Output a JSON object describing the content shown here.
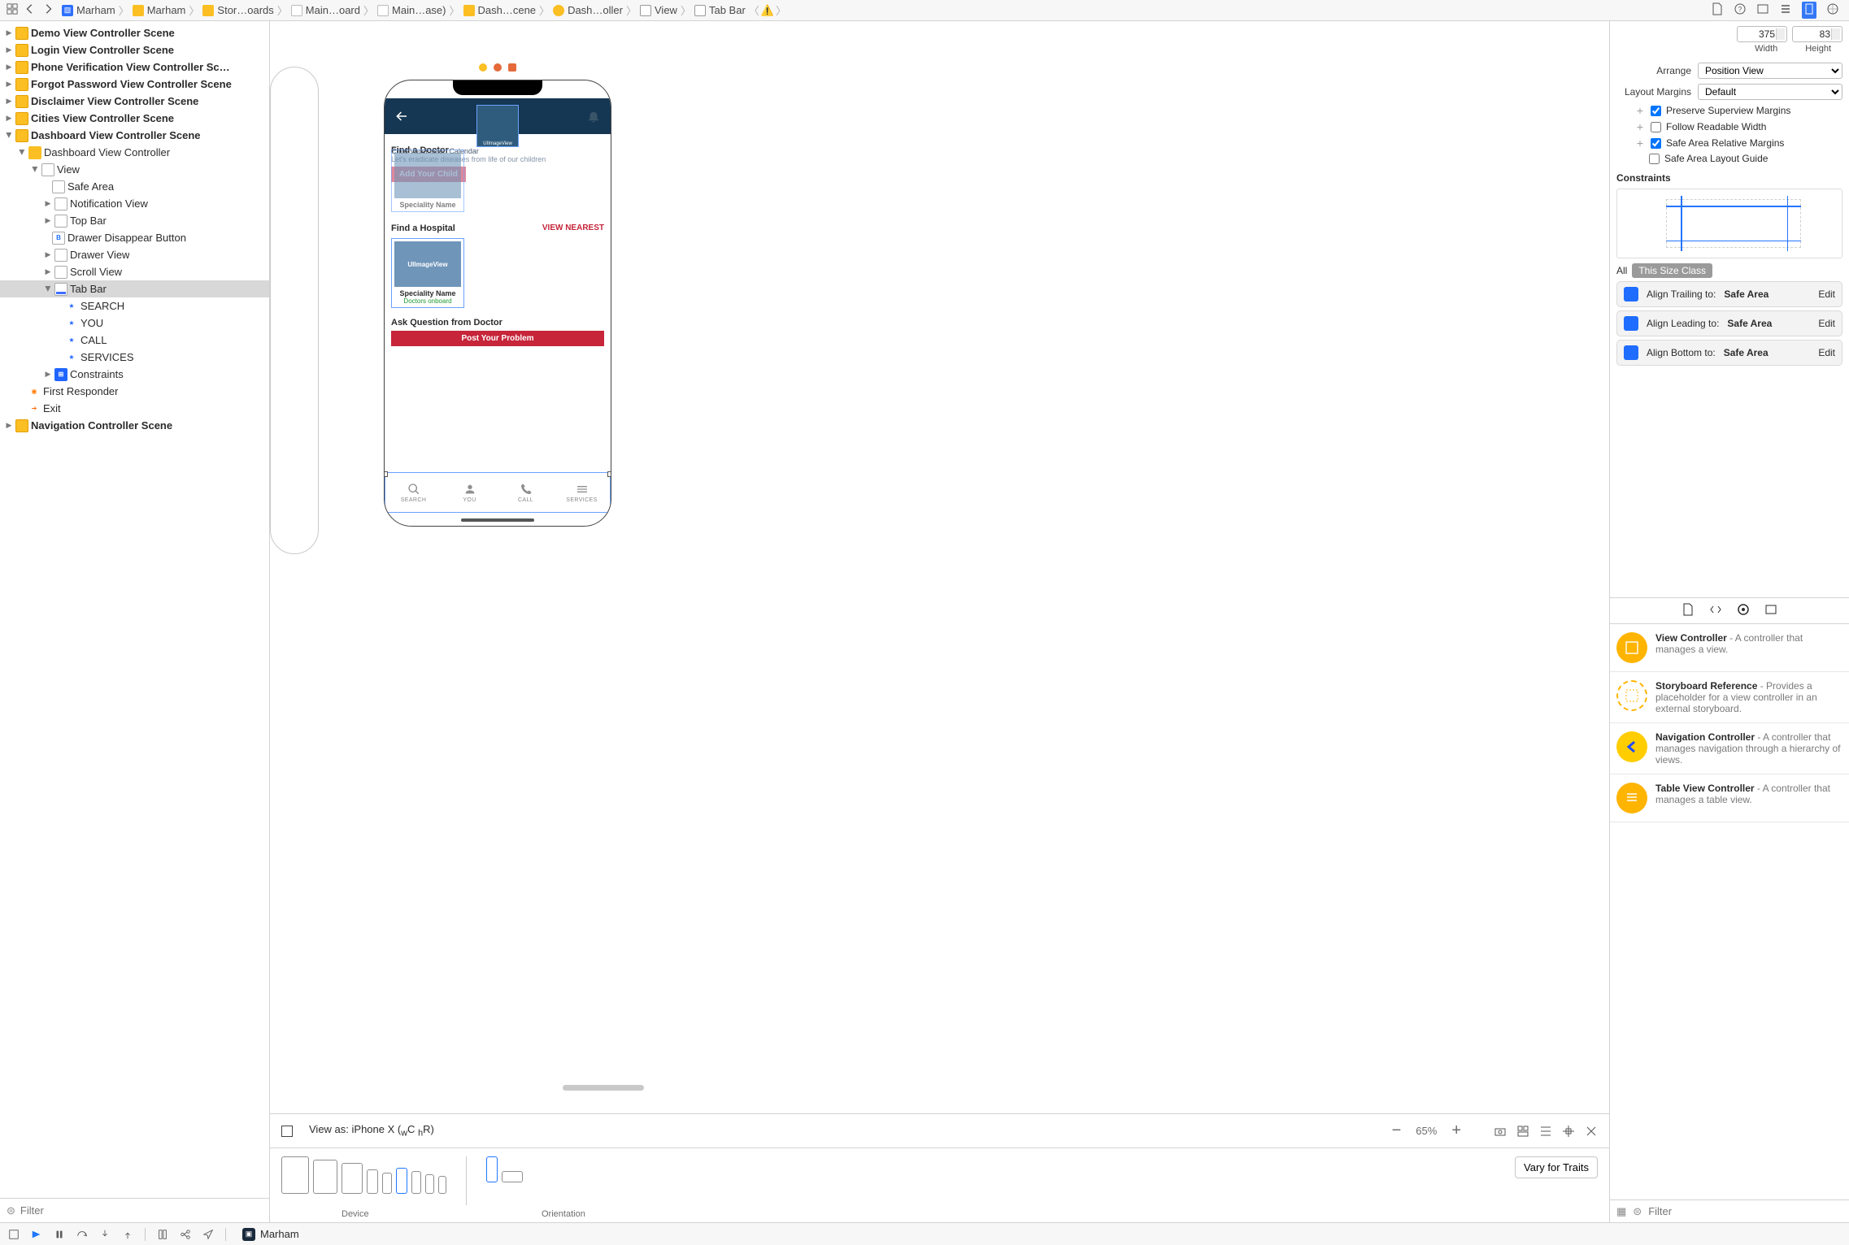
{
  "breadcrumb": [
    {
      "label": "Marham",
      "icon": "blue-doc"
    },
    {
      "label": "Marham",
      "icon": "folder"
    },
    {
      "label": "Stor…oards",
      "icon": "folder"
    },
    {
      "label": "Main…oard",
      "icon": "story"
    },
    {
      "label": "Main…ase)",
      "icon": "story"
    },
    {
      "label": "Dash…cene",
      "icon": "scene"
    },
    {
      "label": "Dash…oller",
      "icon": "vc"
    },
    {
      "label": "View",
      "icon": "view"
    },
    {
      "label": "Tab Bar",
      "icon": "tab"
    }
  ],
  "outline": {
    "scenes": [
      "Demo View Controller Scene",
      "Login View Controller Scene",
      "Phone Verification View Controller Sc…",
      "Forgot Password View Controller Scene",
      "Disclaimer View Controller Scene",
      "Cities View Controller Scene"
    ],
    "dashboard": {
      "scene": "Dashboard View Controller Scene",
      "vc": "Dashboard View Controller",
      "view": "View",
      "safe": "Safe Area",
      "notif": "Notification View",
      "topbar": "Top Bar",
      "drawerBtn": "Drawer Disappear Button",
      "drawer": "Drawer View",
      "scroll": "Scroll View",
      "tabbar": "Tab Bar",
      "items": [
        "SEARCH",
        "YOU",
        "CALL",
        "SERVICES"
      ],
      "constraints": "Constraints",
      "first": "First Responder",
      "exit": "Exit"
    },
    "nav": "Navigation Controller Scene",
    "filter_placeholder": "Filter"
  },
  "canvas": {
    "phone": {
      "findDoctor": "Find a Doctor",
      "calendar": "Child Vaccination Calendar",
      "eradicat": "Let's eradicate diseases from life of our children",
      "addChild": "Add Your Child",
      "specName": "Speciality Name",
      "findHosp": "Find a Hospital",
      "viewNear": "VIEW NEAREST",
      "uiiv": "UIImageView",
      "docOnboard": "Doctors onboard",
      "ask": "Ask Question from Doctor",
      "post": "Post Your Problem",
      "tabs": [
        "SEARCH",
        "YOU",
        "CALL",
        "SERVICES"
      ]
    }
  },
  "traits": {
    "viewAs": "View as: iPhone X (",
    "wcr": "C",
    "hcr": "R)",
    "zoom": "65%",
    "deviceLabel": "Device",
    "orientationLabel": "Orientation",
    "vary": "Vary for Traits"
  },
  "inspector": {
    "width": "375",
    "height": "83",
    "widthLabel": "Width",
    "heightLabel": "Height",
    "arrangeLabel": "Arrange",
    "arrangeVal": "Position View",
    "marginsLabel": "Layout Margins",
    "marginsVal": "Default",
    "presSuper": "Preserve Superview Margins",
    "followRead": "Follow Readable Width",
    "safeRel": "Safe Area Relative Margins",
    "safeGuide": "Safe Area Layout Guide",
    "constraints": "Constraints",
    "all": "All",
    "thisSize": "This Size Class",
    "cons": [
      {
        "t": "Align Trailing to:",
        "v": "Safe Area",
        "e": "Edit"
      },
      {
        "t": "Align Leading to:",
        "v": "Safe Area",
        "e": "Edit"
      },
      {
        "t": "Align Bottom to:",
        "v": "Safe Area",
        "e": "Edit"
      }
    ]
  },
  "library": {
    "items": [
      {
        "title": "View Controller",
        "desc": " - A controller that manages a view.",
        "style": "solid"
      },
      {
        "title": "Storyboard Reference",
        "desc": " - Provides a placeholder for a view controller in an external storyboard.",
        "style": "dash"
      },
      {
        "title": "Navigation Controller",
        "desc": " - A controller that manages navigation through a hierarchy of views.",
        "style": "nav"
      },
      {
        "title": "Table View Controller",
        "desc": " - A controller that manages a table view.",
        "style": "table"
      }
    ],
    "filter_placeholder": "Filter"
  },
  "bottom": {
    "project": "Marham"
  }
}
